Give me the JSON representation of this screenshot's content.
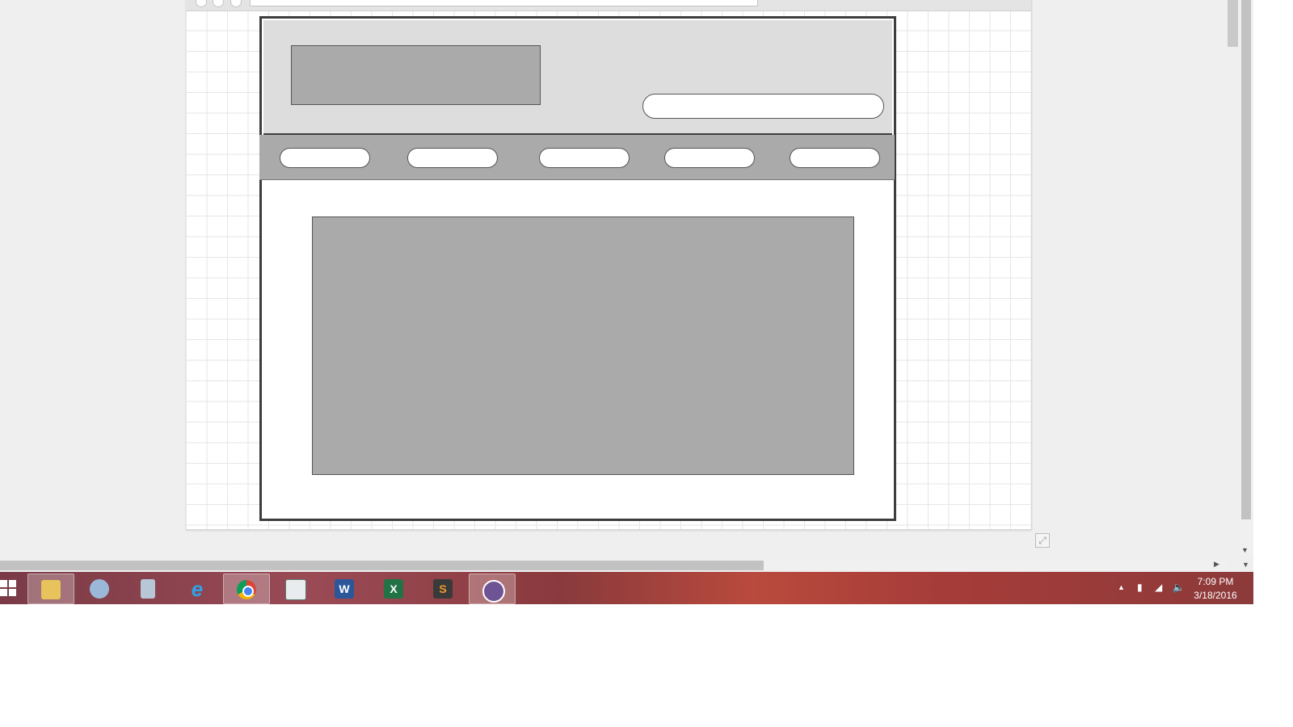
{
  "taskbar": {
    "time": "7:09 PM",
    "date": "3/18/2016",
    "apps": [
      {
        "name": "file-explorer",
        "label": ""
      },
      {
        "name": "paint",
        "label": ""
      },
      {
        "name": "calculator",
        "label": ""
      },
      {
        "name": "internet-explorer",
        "label": "e"
      },
      {
        "name": "chrome",
        "label": ""
      },
      {
        "name": "document-viewer",
        "label": ""
      },
      {
        "name": "word",
        "label": "W"
      },
      {
        "name": "excel",
        "label": "X"
      },
      {
        "name": "sublime-text",
        "label": "S"
      },
      {
        "name": "github",
        "label": ""
      }
    ]
  },
  "colors": {
    "wireframe_border": "#3d3d3d",
    "wireframe_header_fill": "#dddddd",
    "wireframe_block_fill": "#aaaaaa",
    "taskbar_tint": "#9a4a55"
  },
  "icons": {
    "resize": "resize-icon",
    "tray_up": "chevron-up-icon",
    "battery": "battery-icon",
    "signal": "signal-icon",
    "volume": "volume-icon"
  }
}
